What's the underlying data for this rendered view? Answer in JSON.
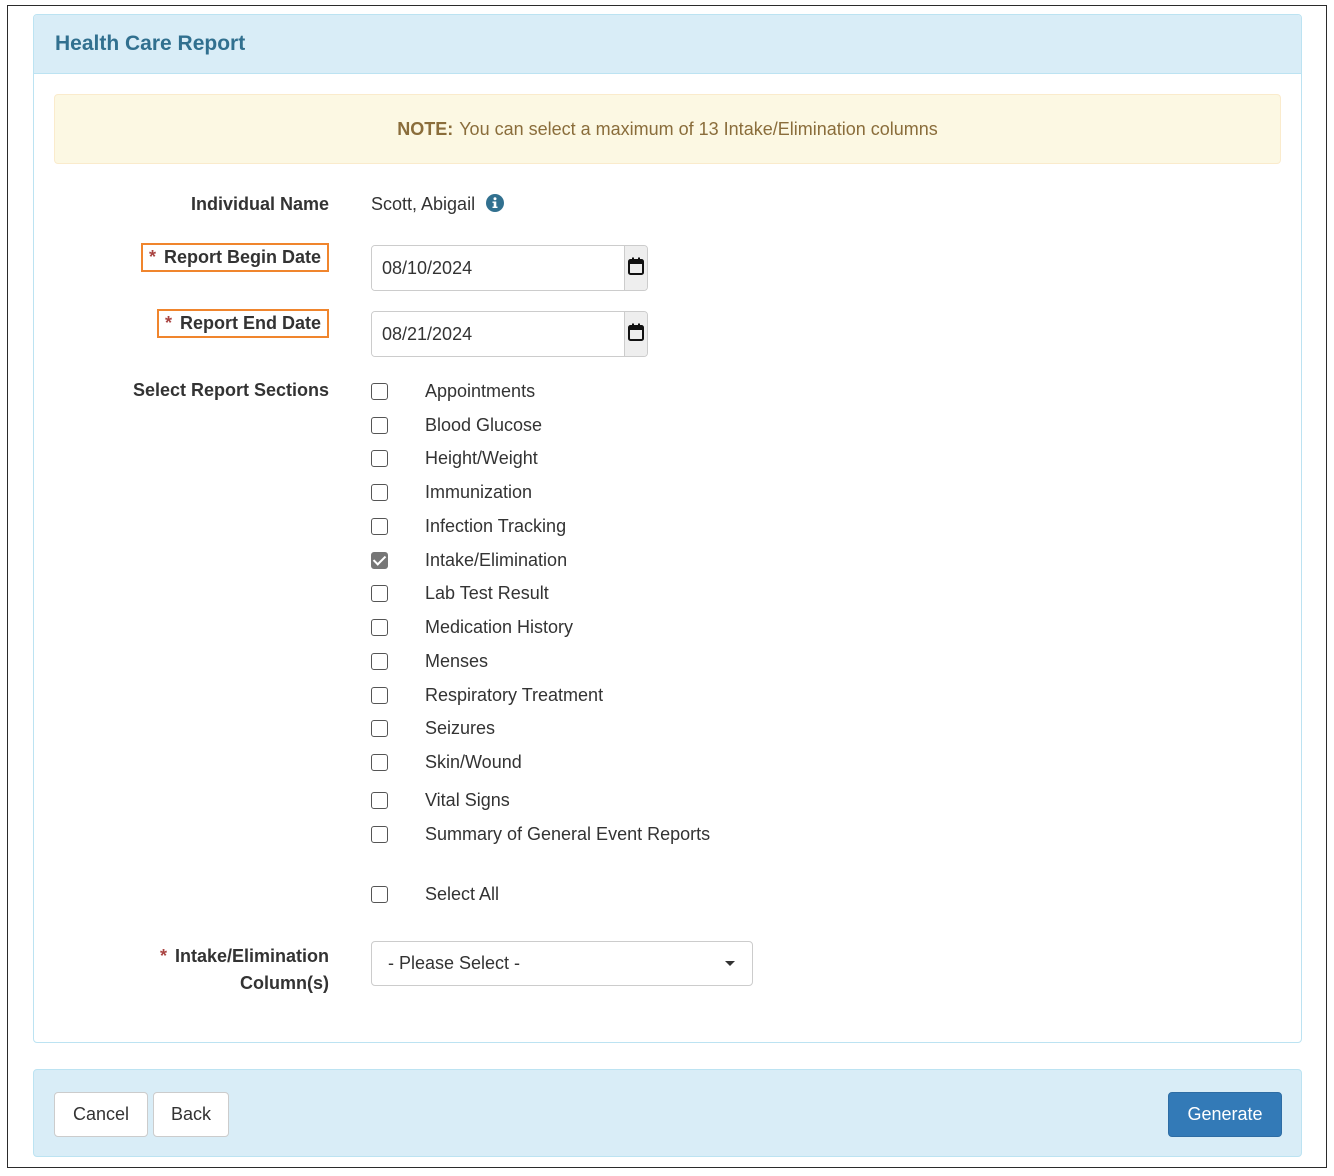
{
  "panel": {
    "title": "Health Care Report"
  },
  "note": {
    "label": "NOTE:",
    "text": "You can select a maximum of 13 Intake/Elimination columns"
  },
  "individual": {
    "label": "Individual Name",
    "value": "Scott, Abigail",
    "info_icon": "info-circle-icon"
  },
  "begin_date": {
    "required_mark": "*",
    "label": "Report Begin Date",
    "value": "08/10/2024",
    "icon": "calendar-icon"
  },
  "end_date": {
    "required_mark": "*",
    "label": "Report End Date",
    "value": "08/21/2024",
    "icon": "calendar-icon"
  },
  "sections": {
    "label": "Select Report Sections",
    "items": [
      {
        "label": "Appointments",
        "checked": false
      },
      {
        "label": "Blood Glucose",
        "checked": false
      },
      {
        "label": "Height/Weight",
        "checked": false
      },
      {
        "label": "Immunization",
        "checked": false
      },
      {
        "label": "Infection Tracking",
        "checked": false
      },
      {
        "label": "Intake/Elimination",
        "checked": true
      },
      {
        "label": "Lab Test Result",
        "checked": false
      },
      {
        "label": "Medication History",
        "checked": false
      },
      {
        "label": "Menses",
        "checked": false
      },
      {
        "label": "Respiratory Treatment",
        "checked": false
      },
      {
        "label": "Seizures",
        "checked": false
      },
      {
        "label": "Skin/Wound",
        "checked": false
      },
      {
        "label": "Vital Signs",
        "checked": false
      },
      {
        "label": "Summary of General Event Reports",
        "checked": false
      }
    ],
    "select_all": {
      "label": "Select All",
      "checked": false
    }
  },
  "columns": {
    "required_mark": "*",
    "label_line1": "Intake/Elimination",
    "label_line2": "Column(s)",
    "selected": "- Please Select -"
  },
  "footer": {
    "cancel_label": "Cancel",
    "back_label": "Back",
    "generate_label": "Generate"
  },
  "colors": {
    "heading_bg": "#d9edf7",
    "heading_text": "#31708f",
    "note_bg": "#fcf8e3",
    "note_text": "#8a6d3b",
    "primary": "#337ab7",
    "highlight_border": "#f0852d",
    "required": "#a94442"
  }
}
